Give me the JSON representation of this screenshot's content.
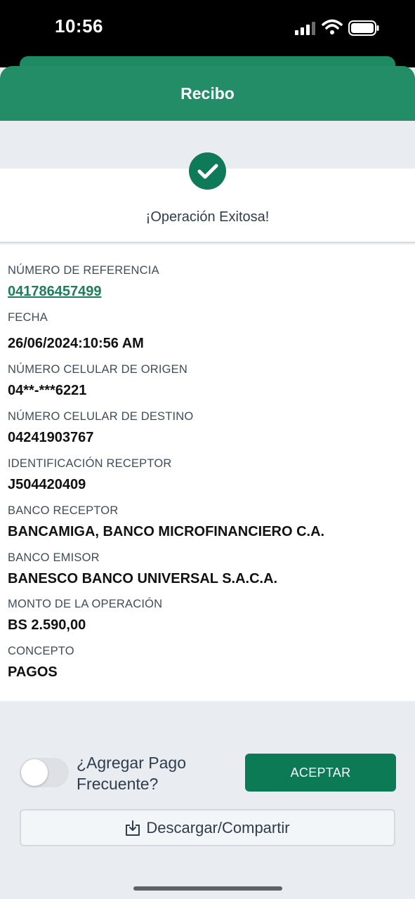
{
  "status_bar": {
    "time": "10:56"
  },
  "header": {
    "title": "Recibo"
  },
  "success": {
    "message": "¡Operación Exitosa!"
  },
  "details": {
    "reference_label": "NÚMERO DE REFERENCIA",
    "reference_value": "041786457499",
    "date_label": "FECHA",
    "date_value": "26/06/2024:10:56 AM",
    "origin_label": "NÚMERO CELULAR DE ORIGEN",
    "origin_value": "04**-***6221",
    "destination_label": "NÚMERO CELULAR DE DESTINO",
    "destination_value": "04241903767",
    "receiver_id_label": "IDENTIFICACIÓN RECEPTOR",
    "receiver_id_value": "J504420409",
    "receiver_bank_label": "BANCO RECEPTOR",
    "receiver_bank_value": "BANCAMIGA, BANCO MICROFINANCIERO C.A.",
    "issuer_bank_label": "BANCO EMISOR",
    "issuer_bank_value": "BANESCO BANCO UNIVERSAL S.A.C.A.",
    "amount_label": "MONTO DE LA OPERACIÓN",
    "amount_value": "BS 2.590,00",
    "concept_label": "CONCEPTO",
    "concept_value": "PAGOS"
  },
  "actions": {
    "frequent_toggle_label": "¿Agregar Pago Frecuente?",
    "frequent_toggle_on": false,
    "accept_label": "ACEPTAR",
    "share_label": "Descargar/Compartir"
  },
  "colors": {
    "header_green": "#238d68",
    "accent_green": "#0c7a55",
    "link_green": "#1f7d5b",
    "background": "#e9edf1"
  },
  "icons": [
    "signal-icon",
    "wifi-icon",
    "battery-icon",
    "check-circle-icon",
    "download-share-icon"
  ]
}
